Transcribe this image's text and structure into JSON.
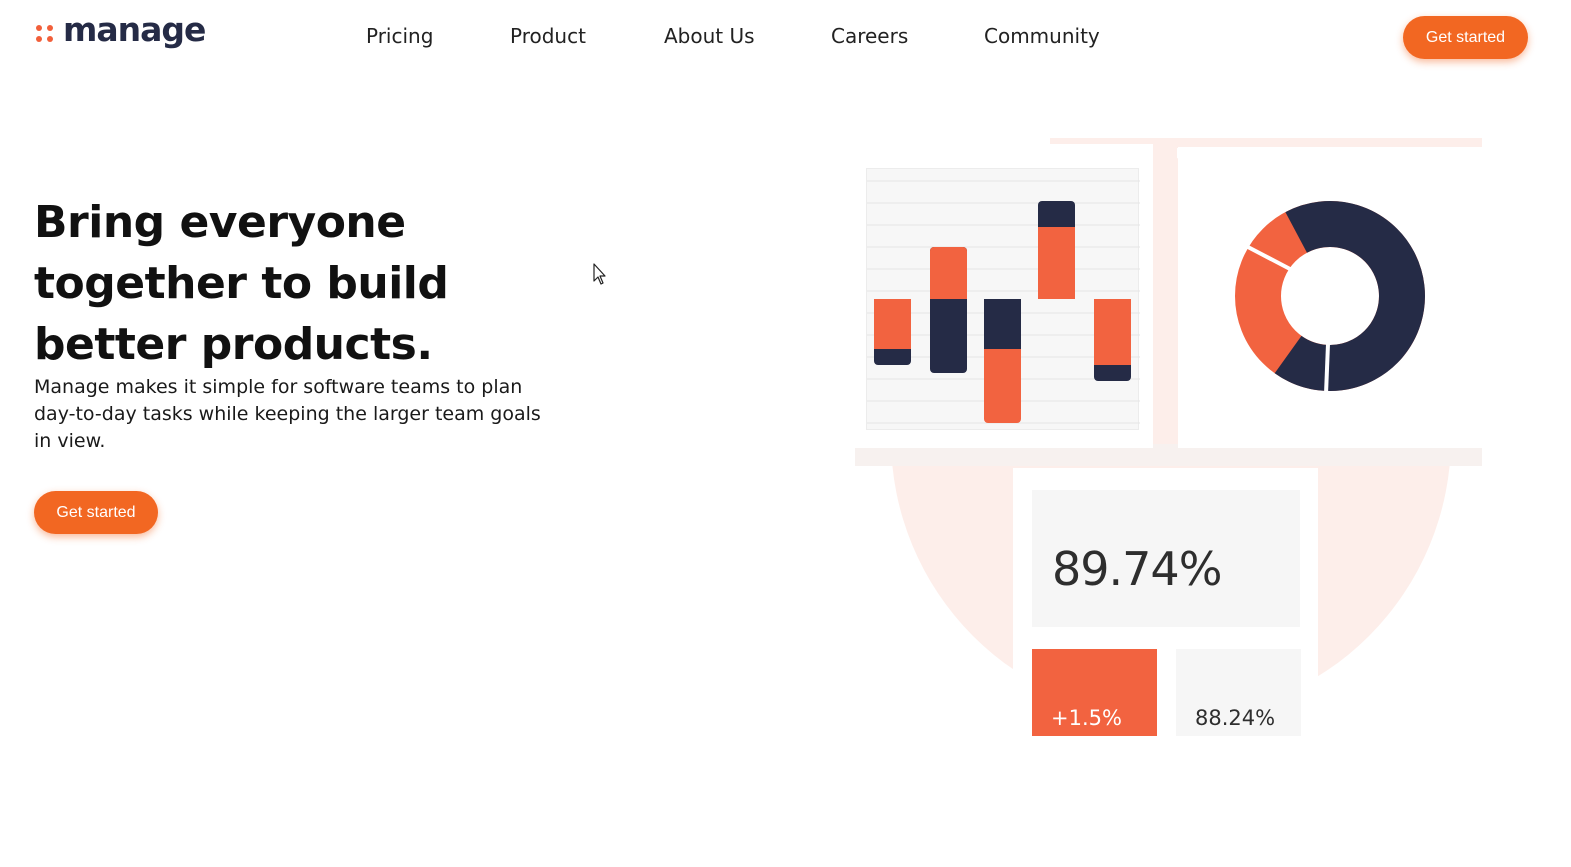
{
  "header": {
    "logo_text": "manage",
    "nav": [
      "Pricing",
      "Product",
      "About Us",
      "Careers",
      "Community"
    ],
    "cta_label": "Get started"
  },
  "hero": {
    "title_lines": [
      "Bring everyone",
      "together to build",
      "better products."
    ],
    "subtitle": "Manage makes it simple for software teams to plan day-to-day tasks while keeping the larger team goals in view.",
    "cta_label": "Get started"
  },
  "illustration": {
    "stat_main": "89.74%",
    "stat_change": "+1.5%",
    "stat_secondary": "88.24%",
    "donut_navy_fraction": 0.67,
    "colors": {
      "orange": "#f26340",
      "navy": "#252b46",
      "accent": "#f26722"
    }
  }
}
